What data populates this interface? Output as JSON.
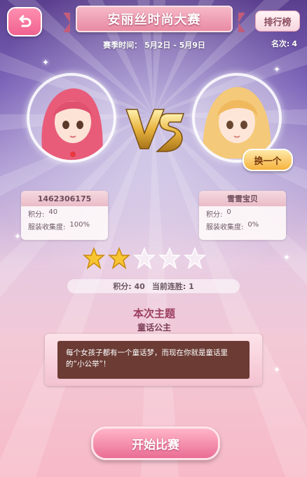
{
  "header": {
    "title": "安丽丝时尚大赛",
    "season_label": "赛季时间：",
    "season_dates": "5月2日 - 5月9日",
    "rank_button": "排行榜",
    "rank_label": "名次:",
    "rank_value": "4"
  },
  "players": {
    "left": {
      "name": "1462306175",
      "score_label": "积分:",
      "score": "40",
      "collection_label": "服装收集度:",
      "collection": "100%"
    },
    "right": {
      "name": "雪雪宝贝",
      "score_label": "积分:",
      "score": "0",
      "collection_label": "服装收集度:",
      "collection": "0%",
      "swap_button": "换一个"
    }
  },
  "stars": {
    "filled": 2,
    "total": 5
  },
  "stats": {
    "score_label": "积分:",
    "score": "40",
    "streak_label": "当前连胜:",
    "streak": "1"
  },
  "theme": {
    "heading": "本次主题",
    "name": "童话公主",
    "description": "每个女孩子都有一个童话梦，而现在你就是童话里的“小公举”！"
  },
  "start_button": "开始比赛",
  "colors": {
    "primary": "#ea6d94",
    "accent": "#f5b33e",
    "theme_box": "#6b3b34"
  }
}
